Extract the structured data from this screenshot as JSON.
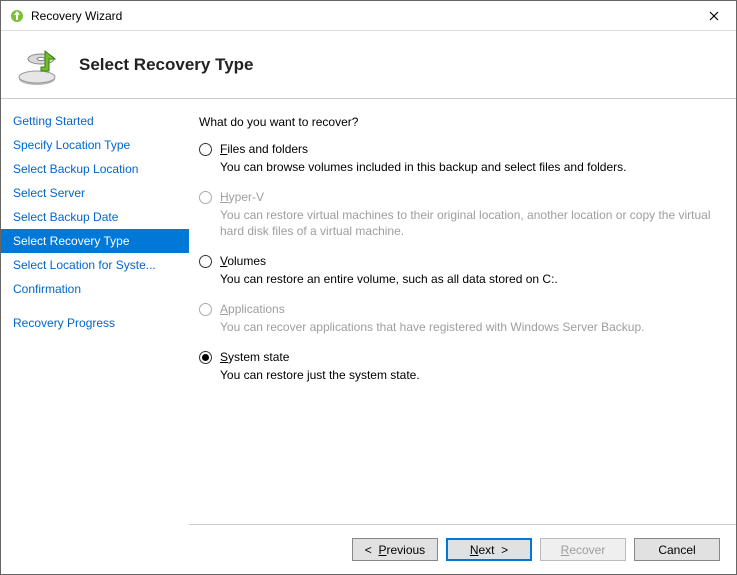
{
  "window": {
    "title": "Recovery Wizard"
  },
  "header": {
    "title": "Select Recovery Type"
  },
  "sidebar": {
    "steps": [
      {
        "label": "Getting Started",
        "active": false
      },
      {
        "label": "Specify Location Type",
        "active": false
      },
      {
        "label": "Select Backup Location",
        "active": false
      },
      {
        "label": "Select Server",
        "active": false
      },
      {
        "label": "Select Backup Date",
        "active": false
      },
      {
        "label": "Select Recovery Type",
        "active": true
      },
      {
        "label": "Select Location for Syste...",
        "active": false
      },
      {
        "label": "Confirmation",
        "active": false
      },
      {
        "label": "Recovery Progress",
        "active": false
      }
    ]
  },
  "content": {
    "question": "What do you want to recover?",
    "options": [
      {
        "accel": "F",
        "label_rest": "iles and folders",
        "desc": "You can browse volumes included in this backup and select files and folders.",
        "disabled": false,
        "selected": false
      },
      {
        "accel": "H",
        "label_rest": "yper-V",
        "desc": "You can restore virtual machines to their original location, another location or copy the virtual hard disk files of a virtual machine.",
        "disabled": true,
        "selected": false
      },
      {
        "accel": "V",
        "label_rest": "olumes",
        "desc": "You can restore an entire volume, such as all data stored on C:.",
        "disabled": false,
        "selected": false
      },
      {
        "accel": "A",
        "label_rest": "pplications",
        "desc": "You can recover applications that have registered with Windows Server Backup.",
        "disabled": true,
        "selected": false
      },
      {
        "accel": "S",
        "label_rest": "ystem state",
        "desc": "You can restore just the system state.",
        "disabled": false,
        "selected": true
      }
    ]
  },
  "footer": {
    "previous_accel": "P",
    "previous_rest": "revious",
    "next_accel": "N",
    "next_rest": "ext",
    "recover_accel": "R",
    "recover_rest": "ecover",
    "cancel": "Cancel"
  }
}
